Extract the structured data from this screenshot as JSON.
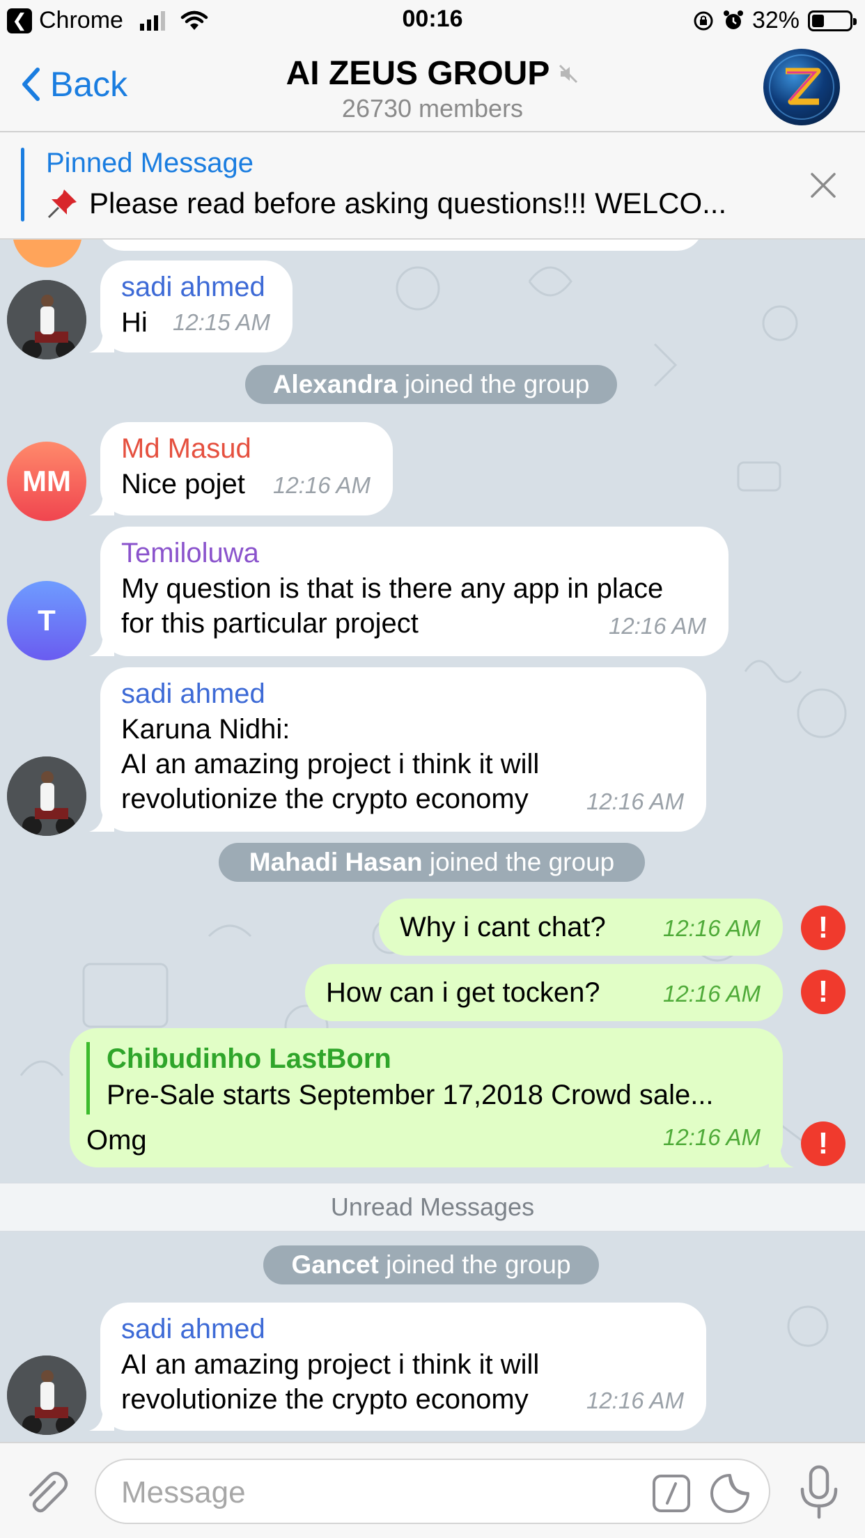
{
  "status_bar": {
    "carrier": "Chrome",
    "time": "00:16",
    "battery": "32%",
    "battery_level": 0.32
  },
  "nav": {
    "back_label": "Back",
    "title": "AI ZEUS GROUP",
    "subtitle": "26730 members"
  },
  "pinned": {
    "title": "Pinned Message",
    "text": "Please read before asking questions!!!  WELCO..."
  },
  "messages": [
    {
      "sender": "sadi ahmed",
      "text": "Hi",
      "time": "12:15 AM"
    },
    {
      "service_name": "Alexandra",
      "service_text": " joined the group"
    },
    {
      "sender": "Md Masud",
      "initials": "MM",
      "text": "Nice pojet",
      "time": "12:16 AM"
    },
    {
      "sender": "Temiloluwa",
      "initials": "T",
      "text_lines": [
        "My question is that is there any app in place",
        "for this particular project"
      ],
      "time": "12:16 AM"
    },
    {
      "sender": "sadi ahmed",
      "text_lines": [
        "Karuna Nidhi:",
        "AI an amazing project i think it will",
        "revolutionize the crypto economy"
      ],
      "time": "12:16 AM"
    },
    {
      "service_name": "Mahadi Hasan",
      "service_text": " joined the group"
    },
    {
      "text": "Why i cant chat?",
      "time": "12:16 AM",
      "error": "!"
    },
    {
      "text": "How can i get tocken?",
      "time": "12:16 AM",
      "error": "!"
    },
    {
      "reply_name": "Chibudinho LastBorn",
      "reply_text": "Pre-Sale starts September 17,2018  Crowd sale...",
      "text": "Omg",
      "time": "12:16 AM",
      "error": "!"
    },
    {
      "service_name": "Gancet",
      "service_text": " joined the group"
    },
    {
      "sender": "sadi ahmed",
      "text_lines": [
        "AI an amazing project i think it will",
        "revolutionize the crypto economy"
      ],
      "time": "12:16 AM"
    }
  ],
  "unread_label": "Unread Messages",
  "input": {
    "placeholder": "Message"
  },
  "colors": {
    "accent": "#1a7de0",
    "outgoing_bubble": "#e1fec6",
    "error": "#f03a2d",
    "name_sadi": "#3d6ad6",
    "name_masud": "#e5503f",
    "name_temi": "#8a53cc"
  }
}
